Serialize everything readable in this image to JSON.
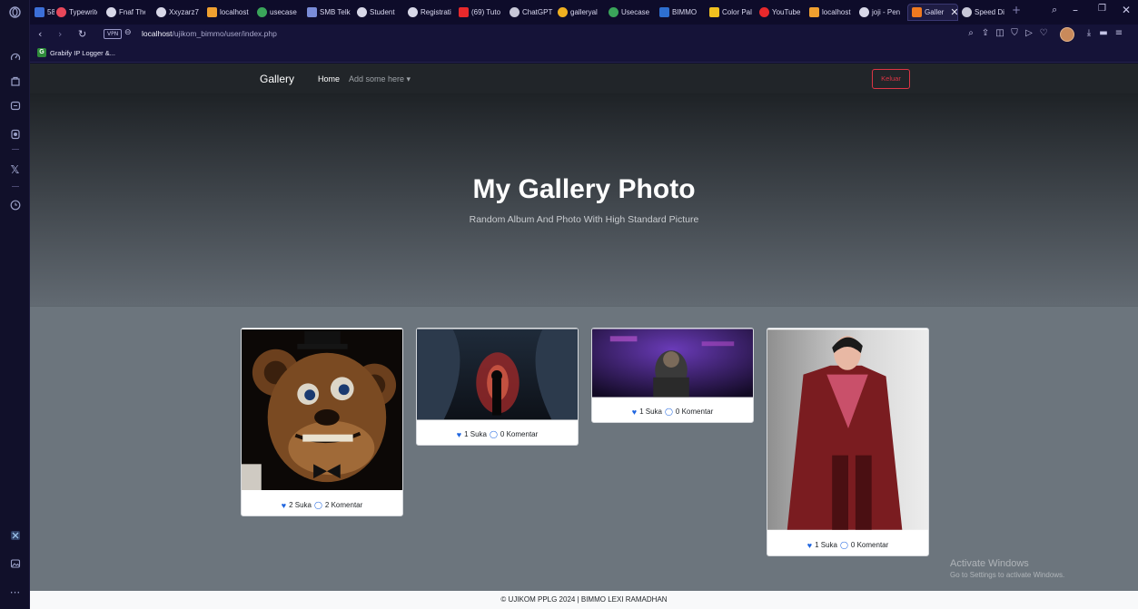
{
  "browser": {
    "tabs": [
      {
        "label": "58",
        "color": "#3c6fd8"
      },
      {
        "label": "Typewrite",
        "color": "#e8475a"
      },
      {
        "label": "Fnaf Ther",
        "color": "#d8d8e8"
      },
      {
        "label": "Xxyzarz7",
        "color": "#d8d8e8"
      },
      {
        "label": "localhost",
        "color": "#f0a030"
      },
      {
        "label": "usecase",
        "color": "#3aa55a"
      },
      {
        "label": "SMB Telk",
        "color": "#7a8cd8"
      },
      {
        "label": "Student",
        "color": "#d8d8e8"
      },
      {
        "label": "Registrati",
        "color": "#d8d8e8"
      },
      {
        "label": "(69) Tuto",
        "color": "#e8292c"
      },
      {
        "label": "ChatGPT",
        "color": "#c8c8d8"
      },
      {
        "label": "galleryal",
        "color": "#f0b020"
      },
      {
        "label": "Usecase",
        "color": "#3aa55a"
      },
      {
        "label": "BIMMO",
        "color": "#2e6fd0"
      },
      {
        "label": "Color Pal",
        "color": "#f0c020"
      },
      {
        "label": "YouTube",
        "color": "#e8292c"
      },
      {
        "label": "localhost",
        "color": "#f0a030"
      },
      {
        "label": "joji - Pen",
        "color": "#d8d8e8"
      },
      {
        "label": "Galler",
        "color": "#f07a20"
      },
      {
        "label": "Speed Di",
        "color": "#c8c8d8"
      }
    ],
    "new_tab": "+",
    "url_host": "localhost",
    "url_path": "/ujikom_bimmo/user/index.php",
    "vpn_label": "VPN",
    "bookmark": "Grabify IP Logger &...",
    "bookmark_icon": "G"
  },
  "navbar": {
    "brand": "Gallery",
    "home": "Home",
    "dropdown": "Add some here ▾",
    "logout": "Keluar"
  },
  "hero": {
    "title": "My Gallery Photo",
    "subtitle": "Random Album And Photo With High Standard Picture"
  },
  "cards": [
    {
      "likes": "2 Suka",
      "comments": "2 Komentar"
    },
    {
      "likes": "1 Suka",
      "comments": "0 Komentar"
    },
    {
      "likes": "1 Suka",
      "comments": "0 Komentar"
    },
    {
      "likes": "1 Suka",
      "comments": "0 Komentar"
    }
  ],
  "footer": "© UJIKOM PPLG 2024 | BIMMO LEXI RAMADHAN",
  "watermark": {
    "title": "Activate Windows",
    "subtitle": "Go to Settings to activate Windows."
  },
  "colors": {
    "navbar_bg": "#212529",
    "body_bg": "#6c757d",
    "accent_blue": "#2066e0",
    "logout_red": "#dc3545"
  }
}
